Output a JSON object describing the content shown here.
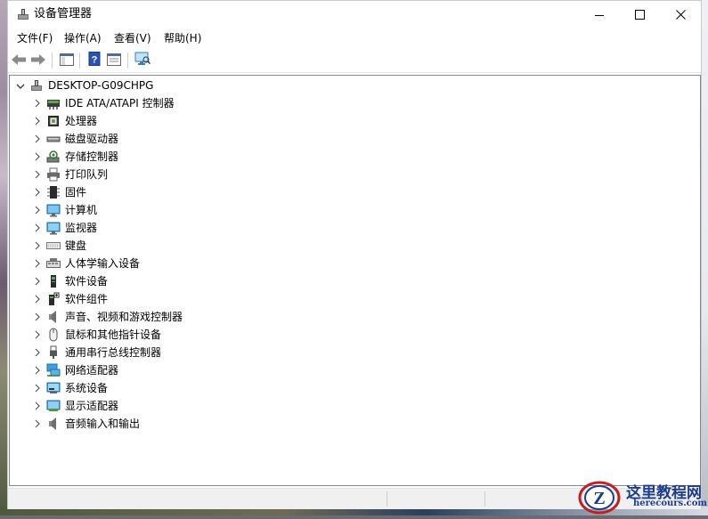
{
  "window": {
    "title": "设备管理器"
  },
  "menu": [
    "文件(F)",
    "操作(A)",
    "查看(V)",
    "帮助(H)"
  ],
  "tree": {
    "root": "DESKTOP-G09CHPG",
    "items": [
      {
        "label": "IDE ATA/ATAPI 控制器",
        "icon": "ide-controller-icon"
      },
      {
        "label": "处理器",
        "icon": "processor-icon"
      },
      {
        "label": "磁盘驱动器",
        "icon": "disk-drive-icon"
      },
      {
        "label": "存储控制器",
        "icon": "storage-controller-icon"
      },
      {
        "label": "打印队列",
        "icon": "printer-icon"
      },
      {
        "label": "固件",
        "icon": "firmware-icon"
      },
      {
        "label": "计算机",
        "icon": "computer-icon"
      },
      {
        "label": "监视器",
        "icon": "monitor-icon"
      },
      {
        "label": "键盘",
        "icon": "keyboard-icon"
      },
      {
        "label": "人体学输入设备",
        "icon": "hid-icon"
      },
      {
        "label": "软件设备",
        "icon": "software-device-icon"
      },
      {
        "label": "软件组件",
        "icon": "software-component-icon"
      },
      {
        "label": "声音、视频和游戏控制器",
        "icon": "sound-icon"
      },
      {
        "label": "鼠标和其他指针设备",
        "icon": "mouse-icon"
      },
      {
        "label": "通用串行总线控制器",
        "icon": "usb-icon"
      },
      {
        "label": "网络适配器",
        "icon": "network-adapter-icon"
      },
      {
        "label": "系统设备",
        "icon": "system-device-icon"
      },
      {
        "label": "显示适配器",
        "icon": "display-adapter-icon"
      },
      {
        "label": "音频输入和输出",
        "icon": "audio-io-icon"
      }
    ]
  },
  "watermark": {
    "title": "这里教程网",
    "url": "herecours.com"
  },
  "colors": {
    "accent": "#1c3d8f",
    "logo_red": "#c41e1e"
  }
}
